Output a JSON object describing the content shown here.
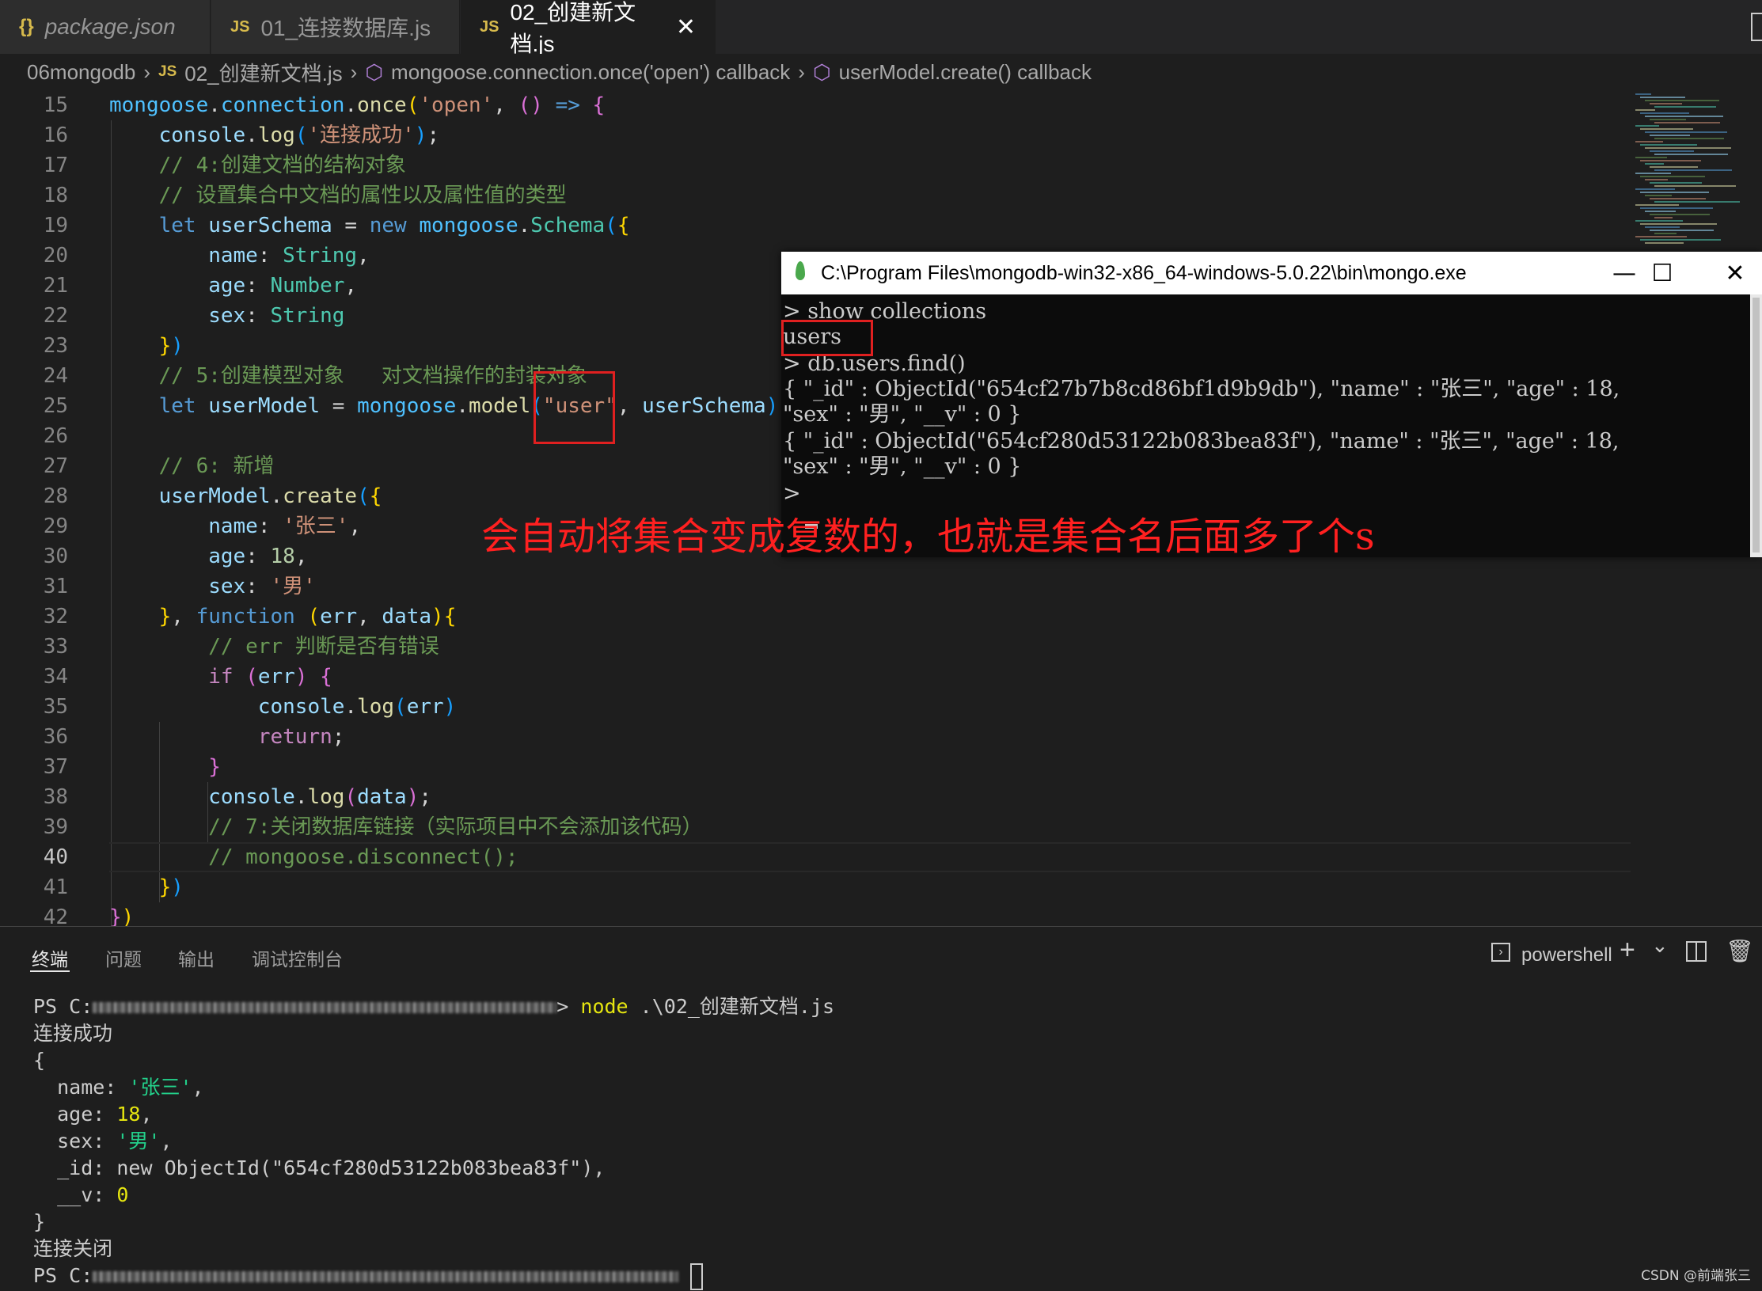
{
  "tabs": [
    {
      "icon": "json-file-icon",
      "label": "package.json"
    },
    {
      "icon": "js-file-icon",
      "label": "01_连接数据库.js"
    },
    {
      "icon": "js-file-icon",
      "label": "02_创建新文档.js",
      "close": "✕"
    }
  ],
  "breadcrumb": {
    "folder": "06mongodb",
    "file_icon": "JS",
    "file": "02_创建新文档.js",
    "symbol1": "mongoose.connection.once('open') callback",
    "symbol2": "userModel.create() callback"
  },
  "editor": {
    "current_line": 40,
    "lines": [
      {
        "n": 15,
        "tokens": [
          [
            "mongoose",
            "c-id"
          ],
          [
            ".",
            "c-p"
          ],
          [
            "connection",
            "c-id"
          ],
          [
            ".",
            "c-p"
          ],
          [
            "once",
            "c-fn"
          ],
          [
            "(",
            "c-br1"
          ],
          [
            "'open'",
            "c-str"
          ],
          [
            ", ",
            "c-p"
          ],
          [
            "()",
            "c-br2"
          ],
          [
            " ",
            "c-p"
          ],
          [
            "=>",
            "c-kw"
          ],
          [
            " ",
            "c-p"
          ],
          [
            "{",
            "c-br2"
          ]
        ]
      },
      {
        "n": 16,
        "tokens": [
          [
            "    console",
            "c-var"
          ],
          [
            ".",
            "c-p"
          ],
          [
            "log",
            "c-fn"
          ],
          [
            "(",
            "c-br3"
          ],
          [
            "'连接成功'",
            "c-str"
          ],
          [
            ")",
            "c-br3"
          ],
          [
            ";",
            "c-p"
          ]
        ]
      },
      {
        "n": 17,
        "tokens": [
          [
            "    // 4:创建文档的结构对象",
            "c-cm"
          ]
        ]
      },
      {
        "n": 18,
        "tokens": [
          [
            "    // 设置集合中文档的属性以及属性值的类型",
            "c-cm"
          ]
        ]
      },
      {
        "n": 19,
        "tokens": [
          [
            "    let ",
            "c-kw"
          ],
          [
            "userSchema",
            "c-var"
          ],
          [
            " = ",
            "c-p"
          ],
          [
            "new ",
            "c-kw"
          ],
          [
            "mongoose",
            "c-id"
          ],
          [
            ".",
            "c-p"
          ],
          [
            "Schema",
            "c-cls"
          ],
          [
            "(",
            "c-br3"
          ],
          [
            "{",
            "c-br1"
          ]
        ]
      },
      {
        "n": 20,
        "tokens": [
          [
            "        name",
            "c-var"
          ],
          [
            ": ",
            "c-p"
          ],
          [
            "String",
            "c-cls"
          ],
          [
            ",",
            "c-p"
          ]
        ]
      },
      {
        "n": 21,
        "tokens": [
          [
            "        age",
            "c-var"
          ],
          [
            ": ",
            "c-p"
          ],
          [
            "Number",
            "c-cls"
          ],
          [
            ",",
            "c-p"
          ]
        ]
      },
      {
        "n": 22,
        "tokens": [
          [
            "        sex",
            "c-var"
          ],
          [
            ": ",
            "c-p"
          ],
          [
            "String",
            "c-cls"
          ]
        ]
      },
      {
        "n": 23,
        "tokens": [
          [
            "    }",
            "c-br1"
          ],
          [
            ")",
            "c-br3"
          ]
        ]
      },
      {
        "n": 24,
        "tokens": [
          [
            "    // 5:创建模型对象   对文档操作的封装对象",
            "c-cm"
          ]
        ]
      },
      {
        "n": 25,
        "tokens": [
          [
            "    let ",
            "c-kw"
          ],
          [
            "userModel",
            "c-var"
          ],
          [
            " = ",
            "c-p"
          ],
          [
            "mongoose",
            "c-id"
          ],
          [
            ".",
            "c-p"
          ],
          [
            "model",
            "c-fn"
          ],
          [
            "(",
            "c-br3"
          ],
          [
            "\"user\"",
            "c-str"
          ],
          [
            ", ",
            "c-p"
          ],
          [
            "userSchema",
            "c-var"
          ],
          [
            ")",
            "c-br3"
          ]
        ]
      },
      {
        "n": 26,
        "tokens": []
      },
      {
        "n": 27,
        "tokens": [
          [
            "    // 6: 新增",
            "c-cm"
          ]
        ]
      },
      {
        "n": 28,
        "tokens": [
          [
            "    userModel",
            "c-var"
          ],
          [
            ".",
            "c-p"
          ],
          [
            "create",
            "c-fn"
          ],
          [
            "(",
            "c-br3"
          ],
          [
            "{",
            "c-br1"
          ]
        ]
      },
      {
        "n": 29,
        "tokens": [
          [
            "        name",
            "c-var"
          ],
          [
            ": ",
            "c-p"
          ],
          [
            "'张三'",
            "c-str"
          ],
          [
            ",",
            "c-p"
          ]
        ]
      },
      {
        "n": 30,
        "tokens": [
          [
            "        age",
            "c-var"
          ],
          [
            ": ",
            "c-p"
          ],
          [
            "18",
            "c-num"
          ],
          [
            ",",
            "c-p"
          ]
        ]
      },
      {
        "n": 31,
        "tokens": [
          [
            "        sex",
            "c-var"
          ],
          [
            ": ",
            "c-p"
          ],
          [
            "'男'",
            "c-str"
          ]
        ]
      },
      {
        "n": 32,
        "tokens": [
          [
            "    }",
            "c-br1"
          ],
          [
            ", ",
            "c-p"
          ],
          [
            "function ",
            "c-kw"
          ],
          [
            "(",
            "c-br1"
          ],
          [
            "err",
            "c-var"
          ],
          [
            ", ",
            "c-p"
          ],
          [
            "data",
            "c-var"
          ],
          [
            ")",
            "c-br1"
          ],
          [
            "{",
            "c-br1"
          ]
        ]
      },
      {
        "n": 33,
        "tokens": [
          [
            "        // err 判断是否有错误",
            "c-cm"
          ]
        ]
      },
      {
        "n": 34,
        "tokens": [
          [
            "        if ",
            "c-ctl"
          ],
          [
            "(",
            "c-br2"
          ],
          [
            "err",
            "c-var"
          ],
          [
            ")",
            "c-br2"
          ],
          [
            " ",
            "c-p"
          ],
          [
            "{",
            "c-br2"
          ]
        ]
      },
      {
        "n": 35,
        "tokens": [
          [
            "            console",
            "c-var"
          ],
          [
            ".",
            "c-p"
          ],
          [
            "log",
            "c-fn"
          ],
          [
            "(",
            "c-br3"
          ],
          [
            "err",
            "c-var"
          ],
          [
            ")",
            "c-br3"
          ]
        ]
      },
      {
        "n": 36,
        "tokens": [
          [
            "            return",
            "c-ctl"
          ],
          [
            ";",
            "c-p"
          ]
        ]
      },
      {
        "n": 37,
        "tokens": [
          [
            "        }",
            "c-br2"
          ]
        ]
      },
      {
        "n": 38,
        "tokens": [
          [
            "        console",
            "c-var"
          ],
          [
            ".",
            "c-p"
          ],
          [
            "log",
            "c-fn"
          ],
          [
            "(",
            "c-br2"
          ],
          [
            "data",
            "c-var"
          ],
          [
            ")",
            "c-br2"
          ],
          [
            ";",
            "c-p"
          ]
        ]
      },
      {
        "n": 39,
        "tokens": [
          [
            "        // 7:关闭数据库链接（实际项目中不会添加该代码）",
            "c-cm"
          ]
        ]
      },
      {
        "n": 40,
        "tokens": [
          [
            "        // mongoose.disconnect();",
            "c-cm"
          ]
        ]
      },
      {
        "n": 41,
        "tokens": [
          [
            "    }",
            "c-br1"
          ],
          [
            ")",
            "c-br3"
          ]
        ]
      },
      {
        "n": 42,
        "tokens": [
          [
            "}",
            "c-br2"
          ],
          [
            ")",
            "c-br1"
          ]
        ]
      }
    ]
  },
  "mongo_window": {
    "title": "C:\\Program Files\\mongodb-win32-x86_64-windows-5.0.22\\bin\\mongo.exe",
    "minimize": "—",
    "maximize": "☐",
    "close": "✕",
    "lines": [
      "> show collections",
      "users",
      "> db.users.find()",
      "{ \"_id\" : ObjectId(\"654cf27b7b8cd86bf1d9b9db\"), \"name\" : \"张三\", \"age\" : 18,",
      "\"sex\" : \"男\", \"__v\" : 0 }",
      "{ \"_id\" : ObjectId(\"654cf280d53122b083bea83f\"), \"name\" : \"张三\", \"age\" : 18,",
      "\"sex\" : \"男\", \"__v\" : 0 }",
      ">"
    ]
  },
  "annotation": "会自动将集合变成复数的，也就是集合名后面多了个s",
  "panel": {
    "tabs": [
      "终端",
      "问题",
      "输出",
      "调试控制台"
    ],
    "shell": "powershell",
    "add": "+",
    "dropdown": "⌄",
    "split_icon": "split-terminal-icon",
    "trash_icon": "trash-icon"
  },
  "terminal": {
    "prompt": "PS C:",
    "arrow": ">",
    "command": "node",
    "arg": " .\\02_创建新文档.js",
    "out_connected": "连接成功",
    "open_brace": "{",
    "name_key": "  name: ",
    "name_val": "'张三'",
    "age_key": "  age: ",
    "age_val": "18",
    "sex_key": "  sex: ",
    "sex_val": "'男'",
    "id_line": "  _id: new ObjectId(\"654cf280d53122b083bea83f\"),",
    "v_key": "  __v: ",
    "v_val": "0",
    "close_brace": "}",
    "out_closed": "连接关闭",
    "prompt2": "PS C:"
  },
  "watermark": "CSDN @前端张三",
  "colors": {
    "accent_red": "#e02020",
    "annotation_red": "#ff2020",
    "editor_bg": "#1e1e1e"
  }
}
